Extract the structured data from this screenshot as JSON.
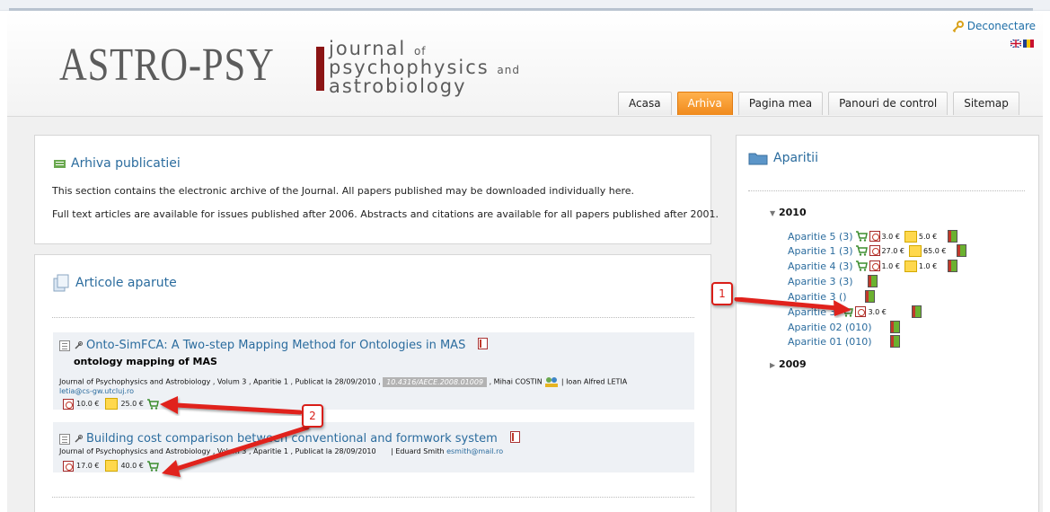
{
  "header": {
    "logo_main": "ASTRO-PSY",
    "logo_line1": "journal",
    "logo_line1_small": "of",
    "logo_line2": "psychophysics",
    "logo_line2_small": "and",
    "logo_line3": "astrobiology",
    "logout_label": "Deconectare",
    "language_flags": [
      "uk-flag-icon",
      "romania-flag-icon"
    ]
  },
  "nav": {
    "tabs": [
      {
        "label": "Acasa",
        "active": false
      },
      {
        "label": "Arhiva",
        "active": true
      },
      {
        "label": "Pagina mea",
        "active": false
      },
      {
        "label": "Panouri de control",
        "active": false
      },
      {
        "label": "Sitemap",
        "active": false
      }
    ]
  },
  "archive": {
    "title": "Arhiva publicatiei",
    "line1": "This section contains the electronic archive of the Journal. All papers published may be downloaded individually here.",
    "line2": "Full text articles are available for issues published after 2006. Abstracts and citations are available for all papers published after 2001."
  },
  "articles_panel": {
    "title": "Articole aparute",
    "articles": [
      {
        "title": "Onto-SimFCA: A Two-step Mapping Method for Ontologies in MAS",
        "subtitle": "ontology mapping of MAS",
        "meta": "Journal of Psychophysics and Astrobiology , Volum 3 , Aparitie 1 , Publicat la 28/09/2010 ,",
        "doi": "10.4316/AECE.2008.01009",
        "author1": ", Mihai COSTIN",
        "author2": "| Ioan Alfred LETIA",
        "email": "letia@cs-gw.utcluj.ro",
        "pdf_price": "10.0 €",
        "abstract_price": "25.0 €"
      },
      {
        "title": "Building cost comparison between conventional and formwork system",
        "meta": "Journal of Psychophysics and Astrobiology , Volum 3 , Aparitie 1 , Publicat la 28/09/2010",
        "author": "| Eduard Smith",
        "email": "esmith@mail.ro",
        "pdf_price": "17.0 €",
        "abstract_price": "40.0 €"
      }
    ]
  },
  "sidebar": {
    "title": "Aparitii",
    "year_2010": "2010",
    "year_2009": "2009",
    "issues": [
      {
        "label": "Aparitie 5 (3)",
        "pdf_price": "3.0 €",
        "abstract_price": "5.0 €"
      },
      {
        "label": "Aparitie 1 (3)",
        "pdf_price": "27.0 €",
        "abstract_price": "65.0 €"
      },
      {
        "label": "Aparitie 4 (3)",
        "pdf_price": "1.0 €",
        "abstract_price": "1.0 €"
      },
      {
        "label": "Aparitie 3 (3)"
      },
      {
        "label": "Aparitie 3 ()"
      },
      {
        "label": "Aparitie 3",
        "pdf_price": "3.0 €"
      },
      {
        "label": "Aparitie 02 (010)"
      },
      {
        "label": "Aparitie 01 (010)"
      }
    ]
  },
  "callouts": {
    "one": "1",
    "two": "2"
  }
}
